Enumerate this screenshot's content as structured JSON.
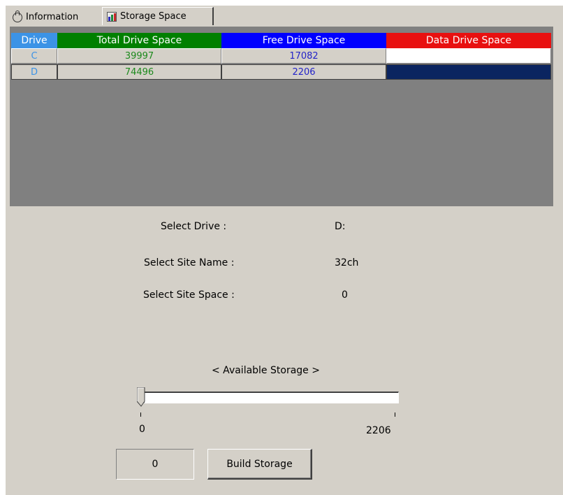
{
  "tabs": {
    "information": "Information",
    "storage_space": "Storage Space"
  },
  "grid": {
    "headers": {
      "drive": "Drive",
      "total": "Total Drive Space",
      "free": "Free Drive Space",
      "data": "Data Drive Space"
    },
    "header_colors": {
      "drive": "#3c93e6",
      "total": "#008000",
      "free": "#0000ff",
      "data": "#e81010"
    },
    "rows": [
      {
        "drive": "C",
        "total": "39997",
        "free": "17082",
        "data_color": "#ffffff"
      },
      {
        "drive": "D",
        "total": "74496",
        "free": "2206",
        "data_color": "#0b2560"
      }
    ]
  },
  "info": {
    "select_drive_label": "Select Drive :",
    "select_drive_value": "D:",
    "select_site_name_label": "Select Site Name :",
    "select_site_name_value": "32ch",
    "select_site_space_label": "Select Site Space :",
    "select_site_space_value": "0"
  },
  "storage": {
    "title": "< Available Storage >",
    "min": "0",
    "max": "2206",
    "slider_value": 0,
    "current_value": "0",
    "build_label": "Build Storage"
  }
}
